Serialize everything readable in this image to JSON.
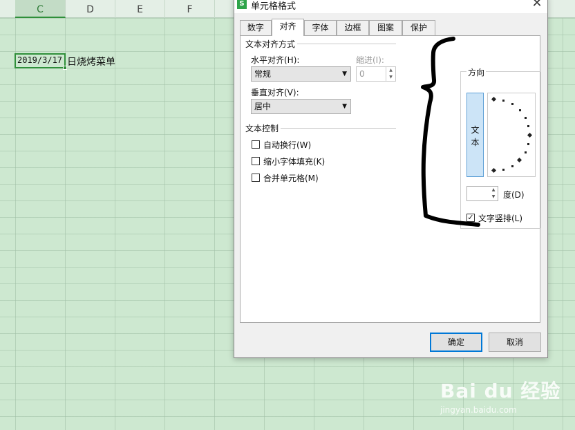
{
  "sheet": {
    "columns": [
      "C",
      "D",
      "E",
      "F"
    ],
    "selected_column": "C",
    "cell_value": "2019/3/17",
    "cell_overflow_text": "日烧烤菜单"
  },
  "dialog": {
    "title": "单元格格式",
    "close_glyph": "✕",
    "app_icon_letter": "S",
    "tabs": [
      {
        "label": "数字",
        "active": false
      },
      {
        "label": "对齐",
        "active": true
      },
      {
        "label": "字体",
        "active": false
      },
      {
        "label": "边框",
        "active": false
      },
      {
        "label": "图案",
        "active": false
      },
      {
        "label": "保护",
        "active": false
      }
    ],
    "text_alignment": {
      "group_label": "文本对齐方式",
      "horizontal_label": "水平对齐(H):",
      "horizontal_value": "常规",
      "indent_label": "缩进(I):",
      "indent_value": "0",
      "vertical_label": "垂直对齐(V):",
      "vertical_value": "居中"
    },
    "text_control": {
      "group_label": "文本控制",
      "options": [
        {
          "label": "自动换行(W)",
          "checked": false
        },
        {
          "label": "缩小字体填充(K)",
          "checked": false
        },
        {
          "label": "合并单元格(M)",
          "checked": false
        }
      ]
    },
    "orientation": {
      "group_label": "方向",
      "vertical_text": "文本",
      "degree_label": "度(D)",
      "degree_value": "",
      "vertical_stack_label": "文字竖排(L)",
      "vertical_stack_checked": true
    },
    "buttons": {
      "ok": "确定",
      "cancel": "取消"
    }
  },
  "watermark": {
    "logo": "Bai du 经验",
    "url": "jingyan.baidu.com"
  },
  "colors": {
    "sheet_bg": "#cde8d0",
    "accent_green": "#2f8f3a",
    "primary_button_border": "#0078d7",
    "vertical_text_bg": "#cce4f7"
  }
}
